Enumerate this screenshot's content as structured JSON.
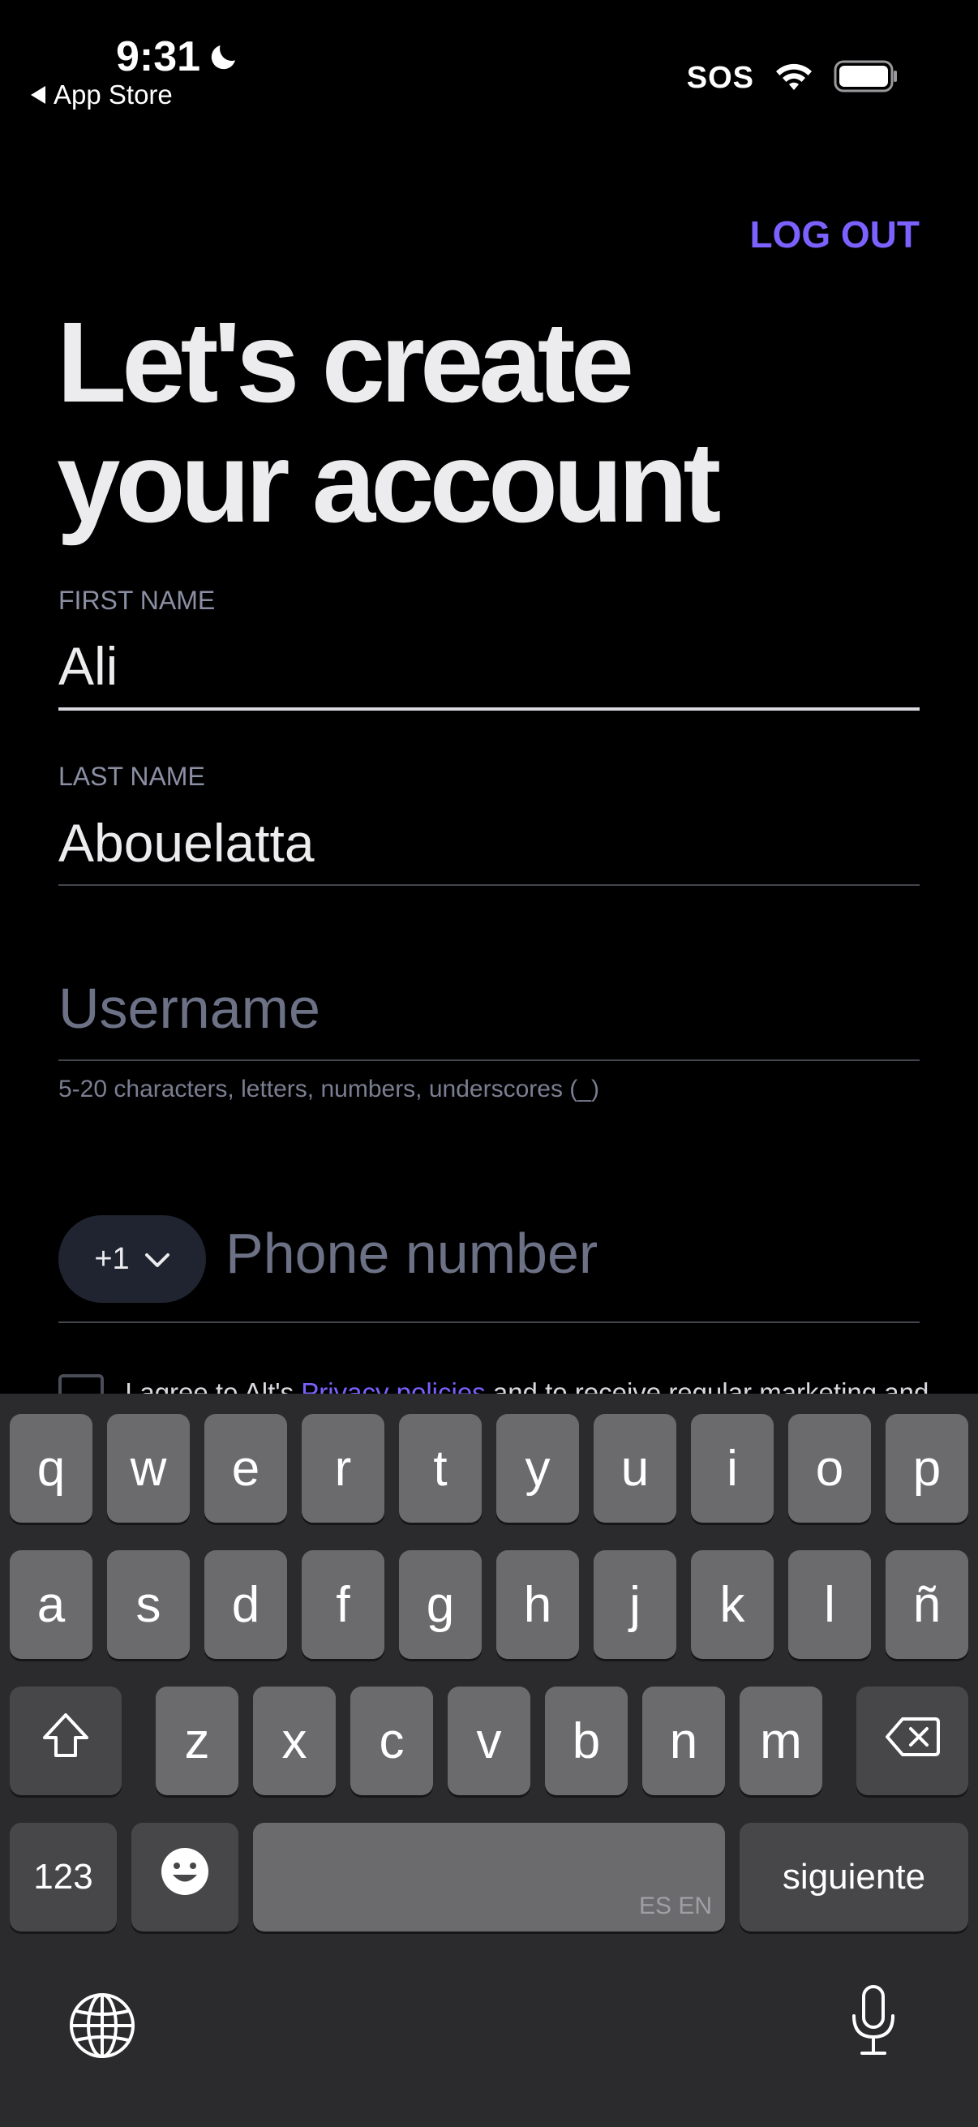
{
  "status_bar": {
    "time": "9:31",
    "back_label": "App Store",
    "sos": "SOS",
    "icons": [
      "moon-icon",
      "wifi-icon",
      "battery-icon"
    ]
  },
  "header": {
    "logout_label": "LOG OUT"
  },
  "title": {
    "line1": "Let's create",
    "line2": "your account"
  },
  "form": {
    "first_name": {
      "label": "FIRST NAME",
      "value": "Ali"
    },
    "last_name": {
      "label": "LAST NAME",
      "value": "Abouelatta"
    },
    "username": {
      "placeholder": "Username",
      "helper": "5-20 characters, letters, numbers, underscores (_)"
    },
    "phone": {
      "country_code": "+1",
      "placeholder": "Phone number"
    },
    "consent": {
      "prefix": "I agree to Alt's ",
      "link": "Privacy policies",
      "suffix": " and to receive regular marketing and"
    }
  },
  "keyboard": {
    "row1": [
      "q",
      "w",
      "e",
      "r",
      "t",
      "y",
      "u",
      "i",
      "o",
      "p"
    ],
    "row2": [
      "a",
      "s",
      "d",
      "f",
      "g",
      "h",
      "j",
      "k",
      "l",
      "ñ"
    ],
    "row3": [
      "z",
      "x",
      "c",
      "v",
      "b",
      "n",
      "m"
    ],
    "numbers_label": "123",
    "space_languages": "ES EN",
    "return_label": "siguiente"
  },
  "colors": {
    "accent": "#7b61ff",
    "background": "#000000",
    "keyboard_bg": "#2b2b2d"
  }
}
